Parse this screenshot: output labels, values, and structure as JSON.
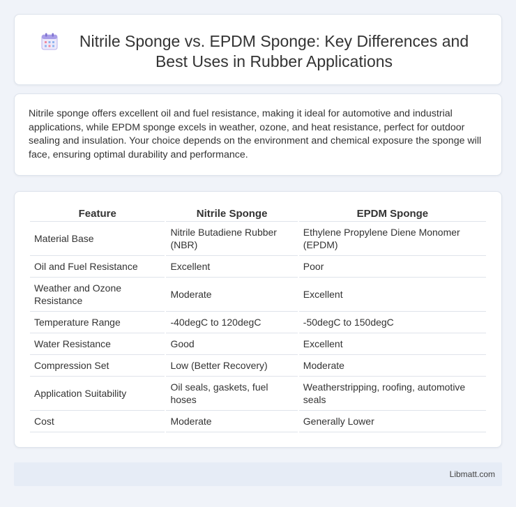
{
  "header": {
    "icon": "calendar-icon",
    "title": "Nitrile Sponge vs. EPDM Sponge: Key Differences and Best Uses in Rubber Applications"
  },
  "summary": {
    "text": "Nitrile sponge offers excellent oil and fuel resistance, making it ideal for automotive and industrial applications, while EPDM sponge excels in weather, ozone, and heat resistance, perfect for outdoor sealing and insulation. Your choice depends on the environment and chemical exposure the sponge will face, ensuring optimal durability and performance."
  },
  "table": {
    "headers": [
      "Feature",
      "Nitrile Sponge",
      "EPDM Sponge"
    ],
    "rows": [
      [
        "Material Base",
        "Nitrile Butadiene Rubber (NBR)",
        "Ethylene Propylene Diene Monomer (EPDM)"
      ],
      [
        "Oil and Fuel Resistance",
        "Excellent",
        "Poor"
      ],
      [
        "Weather and Ozone Resistance",
        "Moderate",
        "Excellent"
      ],
      [
        "Temperature Range",
        "-40degC to 120degC",
        "-50degC to 150degC"
      ],
      [
        "Water Resistance",
        "Good",
        "Excellent"
      ],
      [
        "Compression Set",
        "Low (Better Recovery)",
        "Moderate"
      ],
      [
        "Application Suitability",
        "Oil seals, gaskets, fuel hoses",
        "Weatherstripping, roofing, automotive seals"
      ],
      [
        "Cost",
        "Moderate",
        "Generally Lower"
      ]
    ]
  },
  "footer": {
    "text": "Libmatt.com"
  },
  "colors": {
    "background": "#f0f3f9",
    "card": "#ffffff",
    "footer": "#e6ecf6",
    "icon_accent": "#8b7fd6"
  }
}
